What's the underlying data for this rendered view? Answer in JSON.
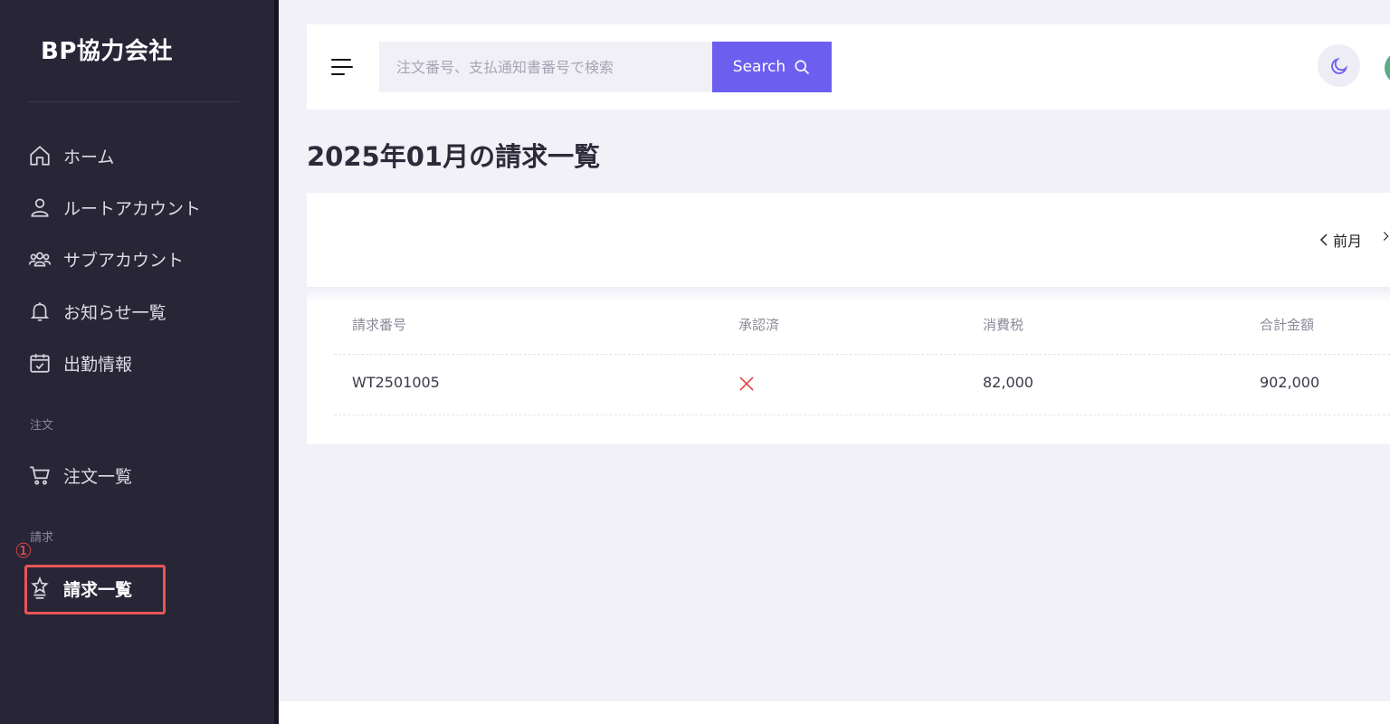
{
  "sidebar": {
    "brand": "BP協力会社",
    "items": [
      {
        "label": "ホーム",
        "icon": "home-icon"
      },
      {
        "label": "ルートアカウント",
        "icon": "user-icon"
      },
      {
        "label": "サブアカウント",
        "icon": "users-icon"
      },
      {
        "label": "お知らせ一覧",
        "icon": "bell-icon"
      },
      {
        "label": "出勤情報",
        "icon": "calendar-check-icon"
      }
    ],
    "section_order": "注文",
    "order_item": {
      "label": "注文一覧",
      "icon": "cart-icon"
    },
    "section_invoice": "請求",
    "invoice_item": {
      "label": "請求一覧",
      "icon": "award-icon"
    },
    "step_marker": "①"
  },
  "topbar": {
    "search_placeholder": "注文番号、支払通知書番号で検索",
    "search_label": "Search"
  },
  "page": {
    "title": "2025年01月の請求一覧"
  },
  "month_nav": {
    "prev": "前月"
  },
  "table": {
    "headers": [
      "請求番号",
      "承認済",
      "消費税",
      "合計金額"
    ],
    "rows": [
      {
        "invoice_no": "WT2501005",
        "approved": false,
        "tax": "82,000",
        "total": "902,000"
      }
    ]
  },
  "colors": {
    "sidebar_bg": "#282537",
    "accent": "#6c5ff0",
    "highlight": "#e85555",
    "reject_x": "#e04848"
  }
}
